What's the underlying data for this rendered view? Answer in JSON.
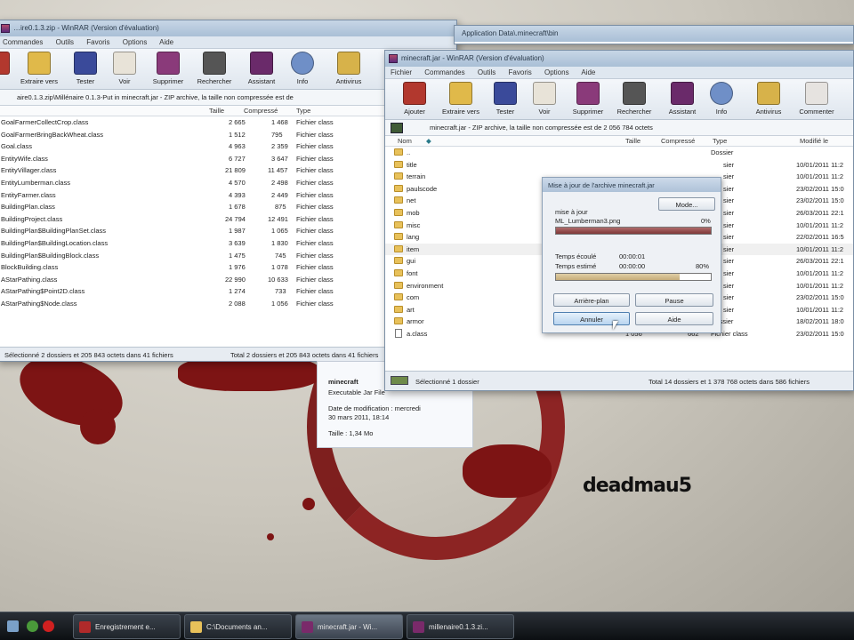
{
  "colors": {
    "accent": "#8a1c1c",
    "rar_purple": "#6a2a7a",
    "folder": "#e8c15a"
  },
  "wallpaper": {
    "text": "deadmau5"
  },
  "back_window": {
    "title": "…ire0.1.3.zip - WinRAR (Version d'évaluation)",
    "menu": [
      "Commandes",
      "Outils",
      "Favoris",
      "Options",
      "Aide"
    ],
    "tools": [
      "Extraire vers",
      "Tester",
      "Voir",
      "Supprimer",
      "Rechercher",
      "Assistant",
      "Info",
      "Antivirus"
    ],
    "path": "aire0.1.3.zip\\Millénaire 0.1.3-Put in minecraft.jar - ZIP archive, la taille non compressée est de",
    "columns": {
      "name": "",
      "size": "Taille",
      "packed": "Compressé",
      "type": "Type"
    },
    "rows": [
      {
        "name": "GoalFarmerCollectCrop.class",
        "size": "2 665",
        "packed": "1 468",
        "type": "Fichier class"
      },
      {
        "name": "GoalFarmerBringBackWheat.class",
        "size": "1 512",
        "packed": "795",
        "type": "Fichier class"
      },
      {
        "name": "Goal.class",
        "size": "4 963",
        "packed": "2 359",
        "type": "Fichier class"
      },
      {
        "name": "EntityWife.class",
        "size": "6 727",
        "type": "Fichier class",
        "packed": "3 647"
      },
      {
        "name": "EntityVillager.class",
        "size": "21 809",
        "packed": "11 457",
        "type": "Fichier class"
      },
      {
        "name": "EntityLumberman.class",
        "size": "4 570",
        "packed": "2 498",
        "type": "Fichier class"
      },
      {
        "name": "EntityFarmer.class",
        "size": "4 393",
        "packed": "2 449",
        "type": "Fichier class"
      },
      {
        "name": "BuildingPlan.class",
        "size": "1 678",
        "packed": "875",
        "type": "Fichier class"
      },
      {
        "name": "BuildingProject.class",
        "size": "24 794",
        "packed": "12 491",
        "type": "Fichier class"
      },
      {
        "name": "BuildingPlan$BuildingPlanSet.class",
        "size": "1 987",
        "packed": "1 065",
        "type": "Fichier class"
      },
      {
        "name": "BuildingPlan$BuildingLocation.class",
        "size": "3 639",
        "packed": "1 830",
        "type": "Fichier class"
      },
      {
        "name": "BuildingPlan$BuildingBlock.class",
        "size": "1 475",
        "packed": "745",
        "type": "Fichier class"
      },
      {
        "name": "BlockBuilding.class",
        "size": "1 976",
        "packed": "1 078",
        "type": "Fichier class"
      },
      {
        "name": "AStarPathing.class",
        "size": "22 990",
        "packed": "10 633",
        "type": "Fichier class"
      },
      {
        "name": "AStarPathing$Point2D.class",
        "size": "1 274",
        "packed": "733",
        "type": "Fichier class"
      },
      {
        "name": "AStarPathing$Node.class",
        "size": "2 088",
        "packed": "1 056",
        "type": "Fichier class"
      }
    ],
    "status_left": "Sélectionné 2 dossiers et 205 843 octets dans 41 fichiers",
    "status_right": "Total 2 dossiers et 205 843 octets dans 41 fichiers"
  },
  "mid_window": {
    "title": "Application Data\\.minecraft\\bin"
  },
  "front_window": {
    "title": "minecraft.jar - WinRAR (Version d'évaluation)",
    "menu": [
      "Fichier",
      "Commandes",
      "Outils",
      "Favoris",
      "Options",
      "Aide"
    ],
    "tools": [
      "Ajouter",
      "Extraire vers",
      "Tester",
      "Voir",
      "Supprimer",
      "Rechercher",
      "Assistant",
      "Info",
      "Antivirus",
      "Commenter"
    ],
    "path": "minecraft.jar - ZIP archive, la taille non compressée est de 2 056 784 octets",
    "columns": {
      "name": "Nom",
      "size": "Taille",
      "packed": "Compressé",
      "type": "Type",
      "modified": "Modifié le"
    },
    "rows": [
      {
        "name": "..",
        "size": "",
        "packed": "",
        "type": "Dossier",
        "modified": "",
        "kind": "folder"
      },
      {
        "name": "title",
        "size": "",
        "packed": "",
        "type": "sier",
        "modified": "10/01/2011 11:2",
        "kind": "folder"
      },
      {
        "name": "terrain",
        "size": "",
        "packed": "",
        "type": "sier",
        "modified": "10/01/2011 11:2",
        "kind": "folder"
      },
      {
        "name": "paulscode",
        "size": "",
        "packed": "",
        "type": "sier",
        "modified": "23/02/2011 15:0",
        "kind": "folder"
      },
      {
        "name": "net",
        "size": "",
        "packed": "",
        "type": "sier",
        "modified": "23/02/2011 15:0",
        "kind": "folder"
      },
      {
        "name": "mob",
        "size": "",
        "packed": "",
        "type": "sier",
        "modified": "26/03/2011 22:1",
        "kind": "folder"
      },
      {
        "name": "misc",
        "size": "",
        "packed": "",
        "type": "sier",
        "modified": "10/01/2011 11:2",
        "kind": "folder"
      },
      {
        "name": "lang",
        "size": "",
        "packed": "",
        "type": "sier",
        "modified": "22/02/2011 16:5",
        "kind": "folder"
      },
      {
        "name": "item",
        "size": "",
        "packed": "",
        "type": "sier",
        "modified": "10/01/2011 11:2",
        "kind": "folder"
      },
      {
        "name": "gui",
        "size": "",
        "packed": "",
        "type": "sier",
        "modified": "26/03/2011 22:1",
        "kind": "folder"
      },
      {
        "name": "font",
        "size": "",
        "packed": "",
        "type": "sier",
        "modified": "10/01/2011 11:2",
        "kind": "folder"
      },
      {
        "name": "environment",
        "size": "",
        "packed": "",
        "type": "sier",
        "modified": "10/01/2011 11:2",
        "kind": "folder"
      },
      {
        "name": "com",
        "size": "",
        "packed": "",
        "type": "sier",
        "modified": "23/02/2011 15:0",
        "kind": "folder"
      },
      {
        "name": "art",
        "size": "",
        "packed": "",
        "type": "sier",
        "modified": "10/01/2011 11:2",
        "kind": "folder"
      },
      {
        "name": "armor",
        "size": "",
        "packed": "",
        "type": "Dossier",
        "modified": "18/02/2011 18:0",
        "kind": "folder"
      },
      {
        "name": "a.class",
        "size": "1 056",
        "packed": "662",
        "type": "Fichier class",
        "modified": "23/02/2011 15:0",
        "kind": "file"
      }
    ],
    "status_left": "Sélectionné 1 dossier",
    "status_right": "Total 14 dossiers et 1 378 768 octets dans 586 fichiers"
  },
  "dialog": {
    "title": "Mise à jour de l'archive minecraft.jar",
    "mode_button": "Mode...",
    "action": "mise à jour",
    "file": "ML_Lumberman3.png",
    "file_percent": "0%",
    "file_progress": 1.0,
    "elapsed_label": "Temps écoulé",
    "elapsed_value": "00:00:01",
    "remaining_label": "Temps estimé",
    "remaining_value": "00:00:00",
    "total_percent": "80%",
    "total_progress": 0.8,
    "btn_background": "Arrière-plan",
    "btn_pause": "Pause",
    "btn_cancel": "Annuler",
    "btn_help": "Aide"
  },
  "info_panel": {
    "name": "minecraft",
    "kind": "Executable Jar File",
    "modified_label": "Date de modification : mercredi",
    "modified_value": "30 mars 2011, 18:14",
    "size": "Taille : 1,34 Mo"
  },
  "taskbar": {
    "buttons": [
      {
        "label": "Enregistrement e..."
      },
      {
        "label": "C:\\Documents an..."
      },
      {
        "label": "minecraft.jar - Wi..."
      },
      {
        "label": "millenaire0.1.3.zi..."
      }
    ]
  }
}
